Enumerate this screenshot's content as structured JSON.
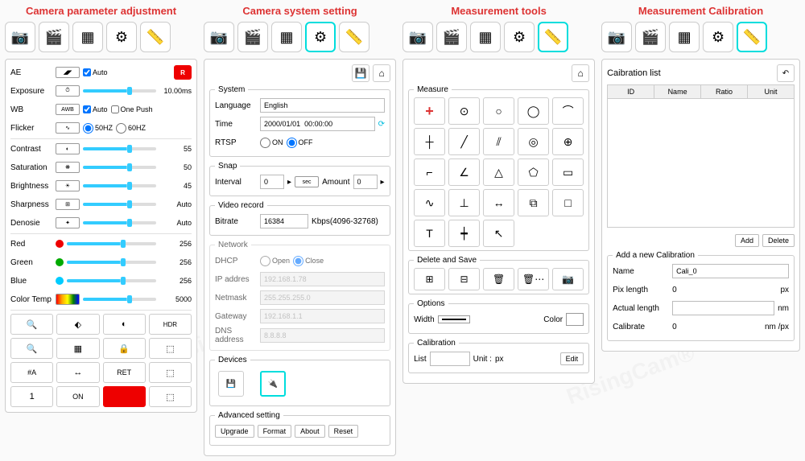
{
  "titles": {
    "param": "Camera parameter adjustment",
    "system": "Camera system setting",
    "tools": "Measurement tools",
    "calib": "Measurement Calibration"
  },
  "toolbar_icons": [
    "camera-icon",
    "video-icon",
    "grid-icon",
    "gear-icon",
    "ruler-icon"
  ],
  "param": {
    "ae": "AE",
    "exposure": "Exposure",
    "exposure_val": "10.00ms",
    "wb": "WB",
    "awb": "AWB",
    "auto": "Auto",
    "onepush": "One Push",
    "flicker": "Flicker",
    "hz50": "50HZ",
    "hz60": "60HZ",
    "contrast": "Contrast",
    "contrast_val": "55",
    "saturation": "Saturation",
    "saturation_val": "50",
    "brightness": "Brightness",
    "brightness_val": "45",
    "sharpness": "Sharpness",
    "sharpness_val": "Auto",
    "denoise": "Denosie",
    "denoise_val": "Auto",
    "red": "Red",
    "red_val": "256",
    "green": "Green",
    "green_val": "256",
    "blue": "Blue",
    "blue_val": "256",
    "colortemp": "Color Temp",
    "colortemp_val": "5000",
    "btns": [
      "🔍+",
      "⬖",
      "◐",
      "HDR",
      "🔍−",
      "▦",
      "🔒",
      "⬚",
      "#A",
      "↔",
      "RET",
      "⬚",
      "1",
      "ON",
      "■",
      "⬚"
    ]
  },
  "system": {
    "system": "System",
    "language": "Language",
    "language_val": "English",
    "time": "Time",
    "time_val": "2000/01/01  00:00:00",
    "rtsp": "RTSP",
    "on": "ON",
    "off": "OFF",
    "snap": "Snap",
    "interval": "Interval",
    "interval_val": "0",
    "sec": "sec",
    "amount": "Amount",
    "amount_val": "0",
    "video": "Video record",
    "bitrate": "Bitrate",
    "bitrate_val": "16384",
    "bitrate_range": "Kbps(4096-32768)",
    "network": "Network",
    "dhcp": "DHCP",
    "open": "Open",
    "close": "Close",
    "ip": "IP addres",
    "ip_val": "192.168.1.78",
    "netmask": "Netmask",
    "netmask_val": "255.255.255.0",
    "gateway": "Gateway",
    "gateway_val": "192.168.1.1",
    "dns": "DNS address",
    "dns_val": "8.8.8.8",
    "devices": "Devices",
    "advanced": "Advanced setting",
    "upgrade": "Upgrade",
    "format": "Format",
    "about": "About",
    "reset": "Reset"
  },
  "tools": {
    "measure": "Measure",
    "delete_save": "Delete and Save",
    "options": "Options",
    "width": "Width",
    "color": "Color",
    "calibration": "Calibration",
    "list": "List",
    "unit": "Unit :",
    "px": "px",
    "edit": "Edit"
  },
  "calib": {
    "list_title": "Caibration list",
    "th_id": "ID",
    "th_name": "Name",
    "th_ratio": "Ratio",
    "th_unit": "Unit",
    "add": "Add",
    "delete": "Delete",
    "add_new": "Add a new Calibration",
    "name": "Name",
    "name_val": "Cali_0",
    "pix": "Pix length",
    "pix_val": "0",
    "px": "px",
    "actual": "Actual length",
    "actual_val": "",
    "nm": "nm",
    "calibrate": "Calibrate",
    "calibrate_val": "0",
    "nmpx": "nm /px"
  }
}
